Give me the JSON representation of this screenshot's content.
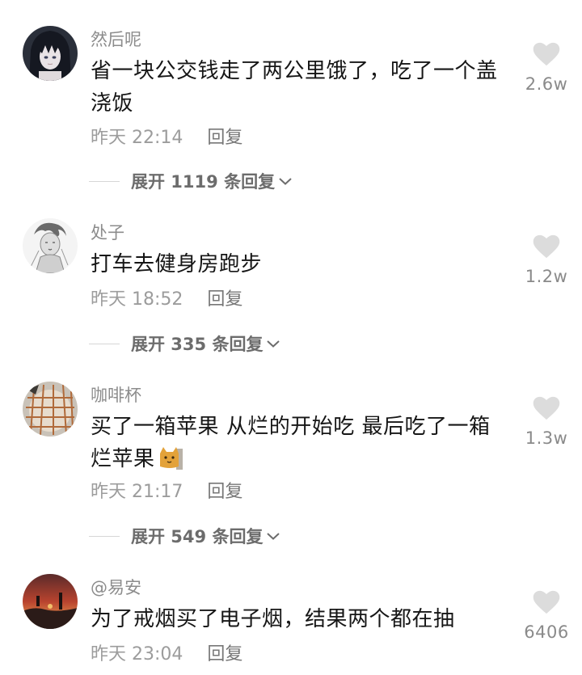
{
  "comments": [
    {
      "username": "然后呢",
      "text": "省一块公交钱走了两公里饿了，吃了一个盖浇饭",
      "time": "昨天 22:14",
      "reply": "回复",
      "likes": "2.6w",
      "expand": "展开 1119 条回复",
      "avatar_icon": "anime-girl-avatar"
    },
    {
      "username": "处子",
      "text": "打车去健身房跑步",
      "time": "昨天 18:52",
      "reply": "回复",
      "likes": "1.2w",
      "expand": "展开 335 条回复",
      "avatar_icon": "sketch-portrait-avatar"
    },
    {
      "username": "咖啡杯",
      "text": "买了一箱苹果 从烂的开始吃 最后吃了一箱烂苹果",
      "time": "昨天 21:17",
      "reply": "回复",
      "likes": "1.3w",
      "expand": "展开 549 条回复",
      "avatar_icon": "fruit-net-avatar",
      "emoji": "cat-face-emoji"
    },
    {
      "username": "@易安",
      "text": "为了戒烟买了电子烟，结果两个都在抽",
      "time": "昨天 23:04",
      "reply": "回复",
      "likes": "6406",
      "avatar_icon": "sunset-avatar"
    }
  ],
  "colors": {
    "text": "#161616",
    "secondary": "#8c8c8c",
    "heart": "#dcdcdc",
    "divider": "#d6d6d6"
  }
}
